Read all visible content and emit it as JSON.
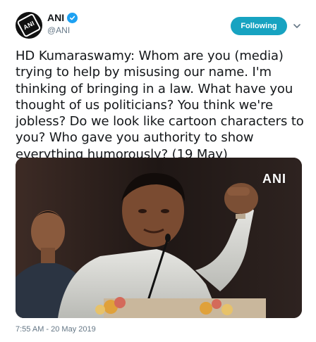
{
  "account": {
    "display_name": "ANI",
    "handle": "@ANI",
    "verified": true,
    "avatar_text": "ANI"
  },
  "follow_button": {
    "label": "Following",
    "color": "#17a3c1"
  },
  "menu": {
    "icon": "chevron-down-icon"
  },
  "tweet": {
    "text": "HD Kumaraswamy: Whom are you (media) trying to help by misusing our name. I'm thinking of bringing in a law. What have you thought of us politicians? You think we're jobless? Do we look like cartoon characters to you? Who gave you authority to show everything humorously? (19 May)"
  },
  "media": {
    "watermark": "ANI"
  },
  "timestamp": "7:55 AM - 20 May 2019",
  "colors": {
    "verified": "#1da1f2",
    "secondary_text": "#657786"
  }
}
